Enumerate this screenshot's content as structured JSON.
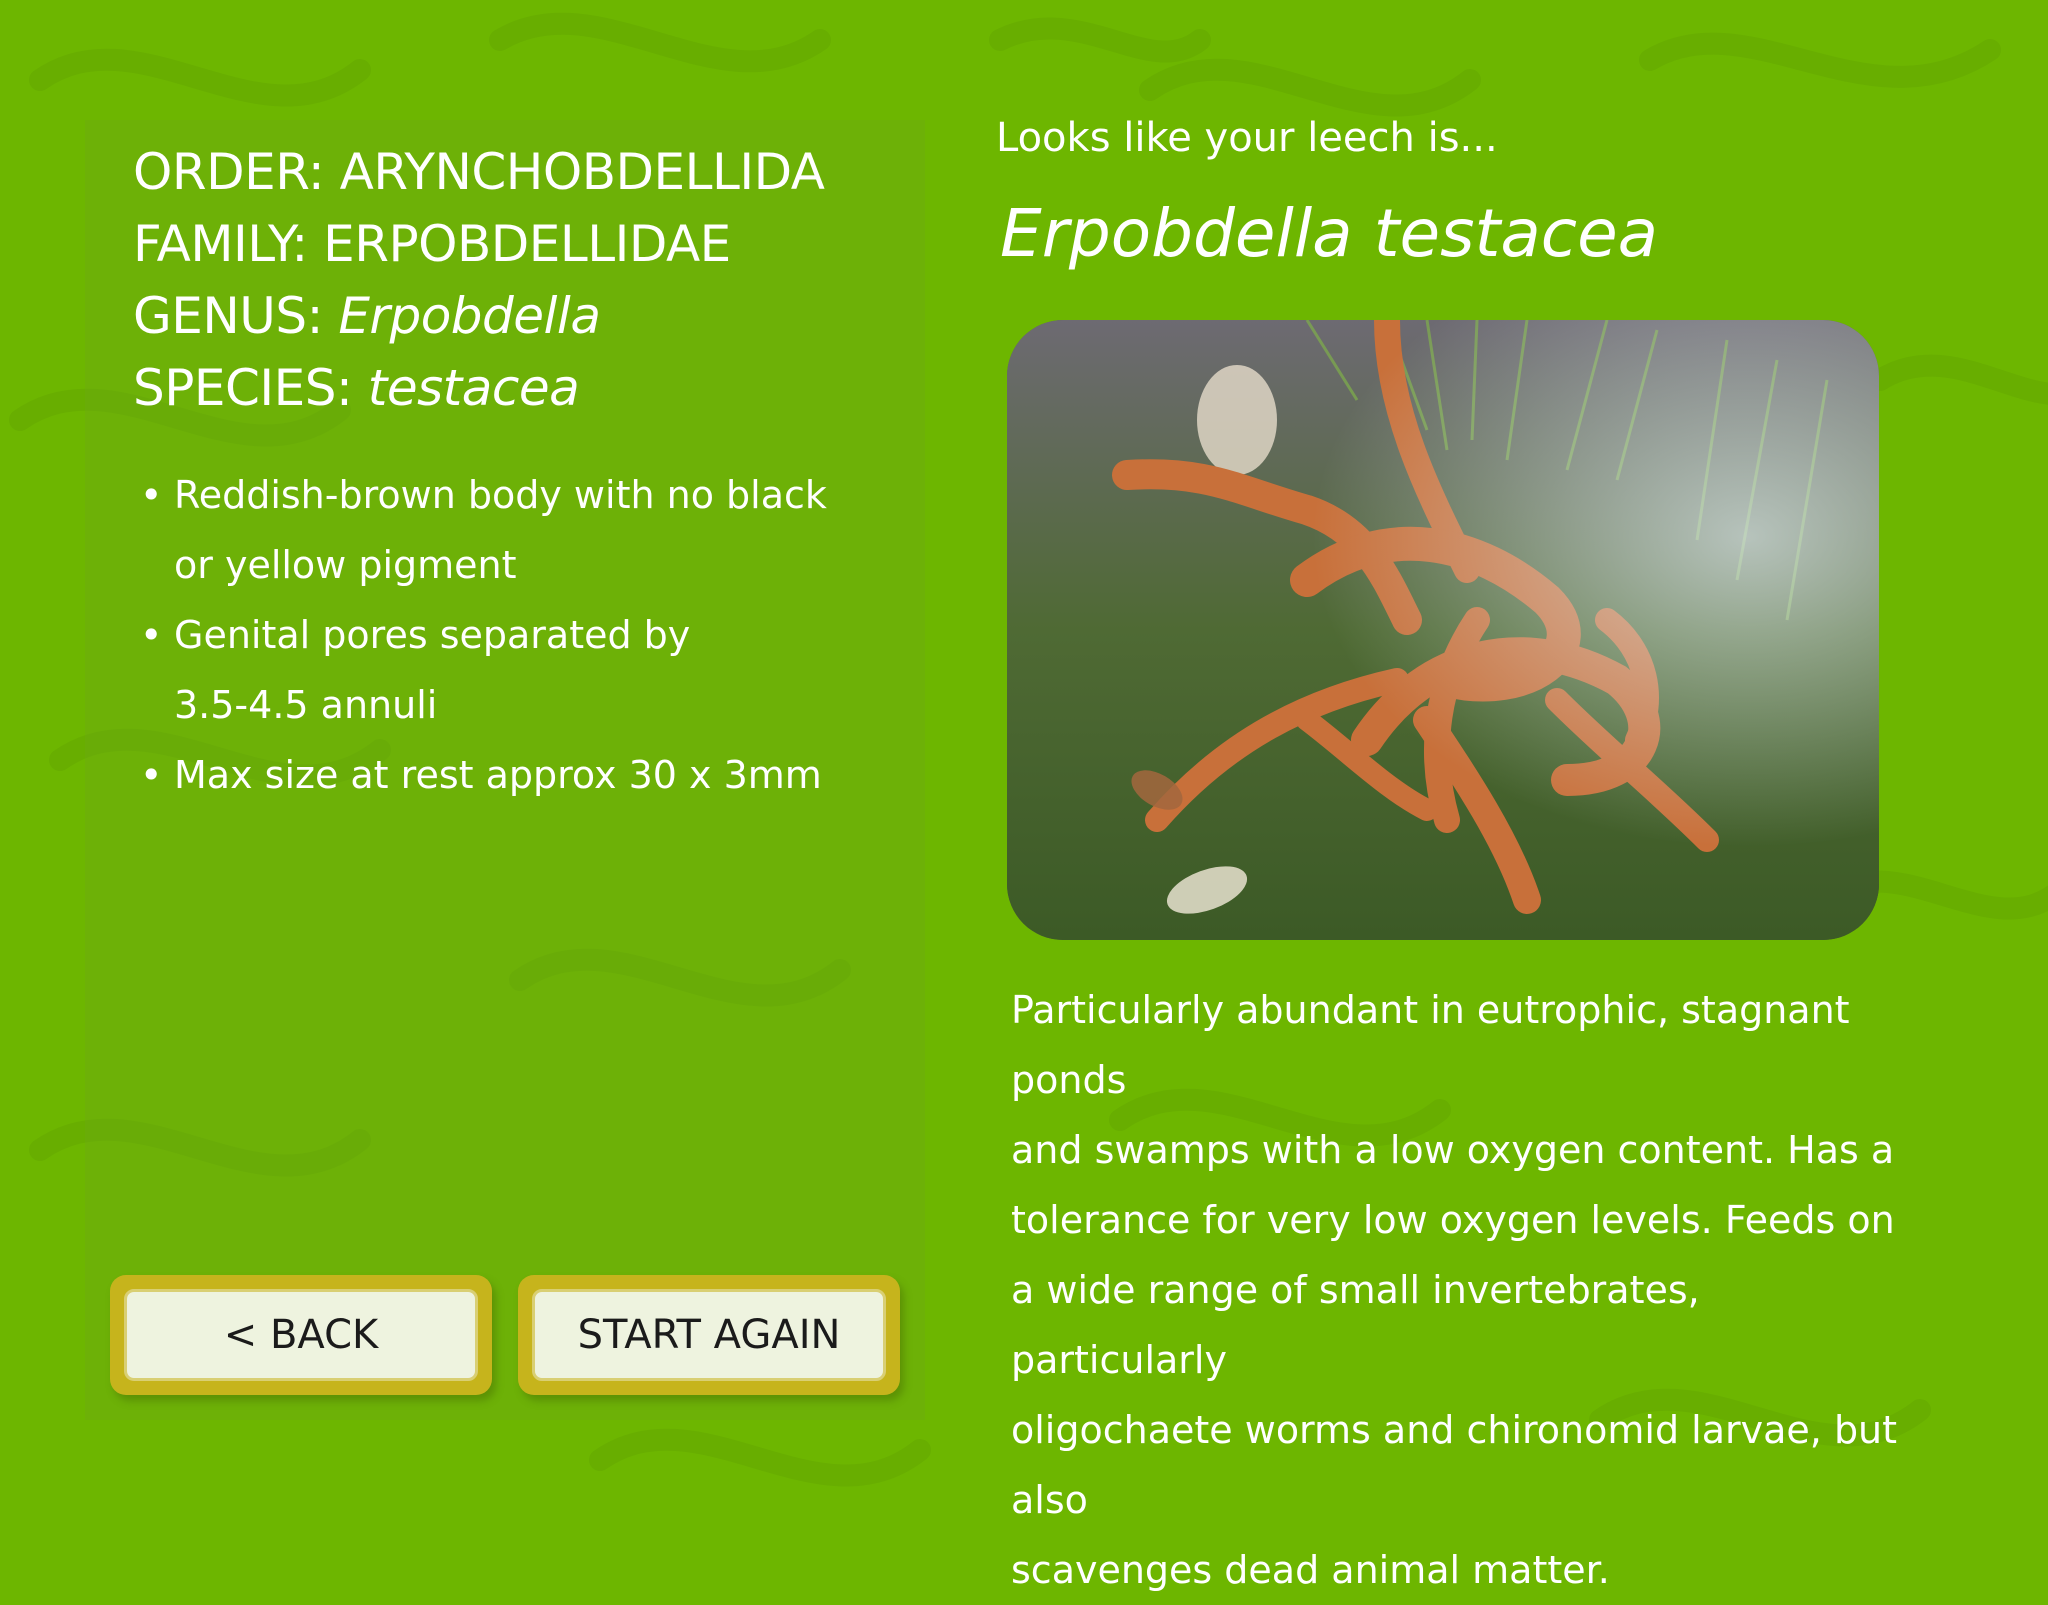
{
  "taxonomy": {
    "order_label": "ORDER:",
    "order_value": "ARYNCHOBDELLIDA",
    "family_label": "FAMILY:",
    "family_value": "ERPOBDELLIDAE",
    "genus_label": "GENUS:",
    "genus_value": "Erpobdella",
    "species_label": "SPECIES:",
    "species_value": "testacea"
  },
  "features": [
    {
      "line1": "Reddish-brown body with no black",
      "line2": "or yellow pigment"
    },
    {
      "line1": "Genital pores separated by",
      "line2": "3.5-4.5 annuli"
    },
    {
      "line1": "Max size at rest approx 30 x 3mm",
      "line2": ""
    }
  ],
  "buttons": {
    "back": "< BACK",
    "start_again": "START AGAIN"
  },
  "result": {
    "intro": "Looks like your leech is...",
    "species_name": "Erpobdella testacea"
  },
  "description": [
    "Particularly abundant in eutrophic, stagnant ponds",
    "and swamps with a low oxygen content. Has a",
    "tolerance for very low oxygen levels. Feeds on",
    "a wide range of small invertebrates, particularly",
    "oligochaete worms and chironomid larvae, but also",
    "scavenges dead animal matter."
  ],
  "colors": {
    "background": "#6db600",
    "button_frame": "#c6b41c",
    "button_face": "#eef3df",
    "leech": "#c8703a"
  }
}
